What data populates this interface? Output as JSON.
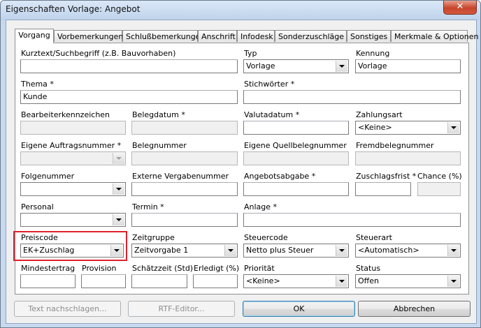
{
  "window": {
    "title": "Eigenschaften Vorlage: Angebot",
    "close_glyph": "✕"
  },
  "tabs": [
    "Vorgang",
    "Vorbemerkungen",
    "Schlußbemerkungen",
    "Anschrift",
    "Infodesk",
    "Sonderzuschläge",
    "Sonstiges",
    "Merkmale & Optionen"
  ],
  "fields": {
    "kurztext": {
      "label": "Kurztext/Suchbegriff (z.B. Bauvorhaben)",
      "value": ""
    },
    "typ": {
      "label": "Typ",
      "value": "Vorlage"
    },
    "kennung": {
      "label": "Kennung",
      "value": "Vorlage"
    },
    "thema": {
      "label": "Thema *",
      "value": "Kunde"
    },
    "stichwoerter": {
      "label": "Stichwörter *",
      "value": ""
    },
    "bearbeiterkennzeichen": {
      "label": "Bearbeiterkennzeichen",
      "value": ""
    },
    "belegdatum": {
      "label": "Belegdatum *",
      "value": ""
    },
    "valutadatum": {
      "label": "Valutadatum *",
      "value": ""
    },
    "zahlungsart": {
      "label": "Zahlungsart",
      "value": "<Keine>"
    },
    "eigene_auftragsnummer": {
      "label": "Eigene Auftragsnummer *",
      "value": ""
    },
    "belegnummer": {
      "label": "Belegnummer",
      "value": ""
    },
    "eigene_quellbelegnummer": {
      "label": "Eigene Quellbelegnummer",
      "value": ""
    },
    "fremdbelegnummer": {
      "label": "Fremdbelegnummer",
      "value": ""
    },
    "folgenummer": {
      "label": "Folgenummer",
      "value": ""
    },
    "externe_vergabenummer": {
      "label": "Externe Vergabenummer",
      "value": ""
    },
    "angebotsabgabe": {
      "label": "Angebotsabgabe *",
      "value": ""
    },
    "zuschlagsfrist": {
      "label": "Zuschlagsfrist *",
      "value": ""
    },
    "chance": {
      "label": "Chance (%)",
      "value": ""
    },
    "personal": {
      "label": "Personal",
      "value": ""
    },
    "termin": {
      "label": "Termin *",
      "value": ""
    },
    "anlage": {
      "label": "Anlage *",
      "value": ""
    },
    "preiscode": {
      "label": "Preiscode",
      "value": "EK+Zuschlag"
    },
    "zeitgruppe": {
      "label": "Zeitgruppe",
      "value": "Zeitvorgabe 1"
    },
    "steuercode": {
      "label": "Steuercode",
      "value": "Netto plus Steuer"
    },
    "steuerart": {
      "label": "Steuerart",
      "value": "<Automatisch>"
    },
    "mindestertrag": {
      "label": "Mindestertrag",
      "value": ""
    },
    "provision": {
      "label": "Provision",
      "value": ""
    },
    "schaetzzeit": {
      "label": "Schätzzeit (Std)",
      "value": ""
    },
    "erledigt": {
      "label": "Erledigt (%)",
      "value": ""
    },
    "prioritaet": {
      "label": "Priorität",
      "value": "<Keine>"
    },
    "status": {
      "label": "Status",
      "value": "Offen"
    }
  },
  "buttons": {
    "text_nachschlagen": "Text nachschlagen...",
    "rtf_editor": "RTF-Editor...",
    "ok": "OK",
    "abbrechen": "Abbrechen"
  },
  "colors": {
    "highlight": "#e0202b"
  }
}
